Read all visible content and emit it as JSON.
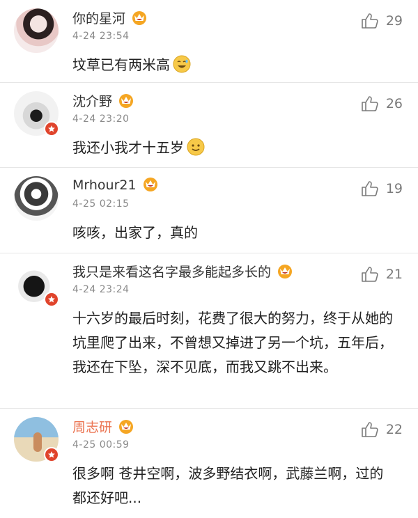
{
  "comments": [
    {
      "username": "你的星河",
      "time": "4-24 23:54",
      "text": "坟草已有两米高",
      "likes": "29",
      "emoji": "laughing-emoji",
      "username_color": "#333333"
    },
    {
      "username": "沈介野",
      "time": "4-24 23:20",
      "text": "我还小我才十五岁",
      "likes": "26",
      "emoji": "smile-emoji",
      "username_color": "#333333"
    },
    {
      "username": "Mrhour21",
      "time": "4-25 02:15",
      "text": "咳咳，出家了，真的",
      "likes": "19",
      "username_color": "#333333"
    },
    {
      "username": "我只是来看这名字最多能起多长的",
      "time": "4-24 23:24",
      "text": "十六岁的最后时刻，花费了很大的努力，终于从她的坑里爬了出来，不曾想又掉进了另一个坑，五年后，我还在下坠，深不见底，而我又跳不出来。",
      "likes": "21",
      "username_color": "#333333"
    },
    {
      "username": "周志研",
      "time": "4-25 00:59",
      "text": "很多啊 苍井空啊，波多野结衣啊，武藤兰啊，过的都还好吧...",
      "likes": "22",
      "username_color": "#eb7350"
    }
  ],
  "icons": {
    "like": "thumbs-up-icon",
    "vip": "vip-crown-icon",
    "badge": "star-badge-icon"
  },
  "colors": {
    "badge_red": "#e0442c",
    "vip_gold": "#f5a623",
    "orange_name": "#eb7350",
    "meta_gray": "#8a8a8a"
  }
}
